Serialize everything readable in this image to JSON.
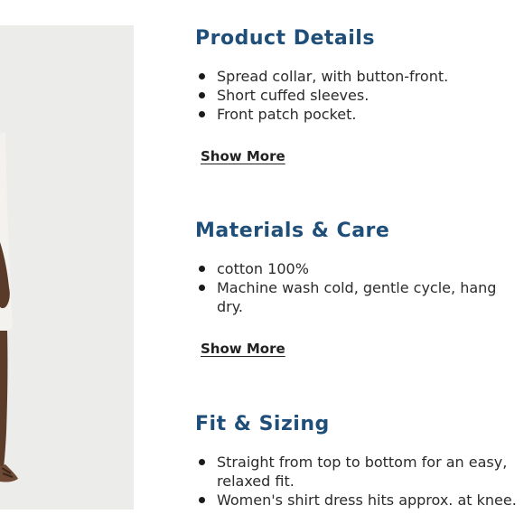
{
  "product_details": {
    "title": "Product Details",
    "items": [
      "Spread collar, with button-front.",
      "Short cuffed sleeves.",
      "Front patch pocket."
    ],
    "show_more_label": "Show More"
  },
  "materials_care": {
    "title": "Materials & Care",
    "items": [
      "cotton 100%",
      "Machine wash cold, gentle cycle, hang dry."
    ],
    "show_more_label": "Show More"
  },
  "fit_sizing": {
    "title": "Fit & Sizing",
    "items": [
      "Straight from top to bottom for an easy, relaxed fit.",
      "Women's shirt dress hits approx. at knee."
    ]
  },
  "colors": {
    "heading": "#1f4e79",
    "text": "#2b2b2b",
    "image_background": "#ececea"
  }
}
